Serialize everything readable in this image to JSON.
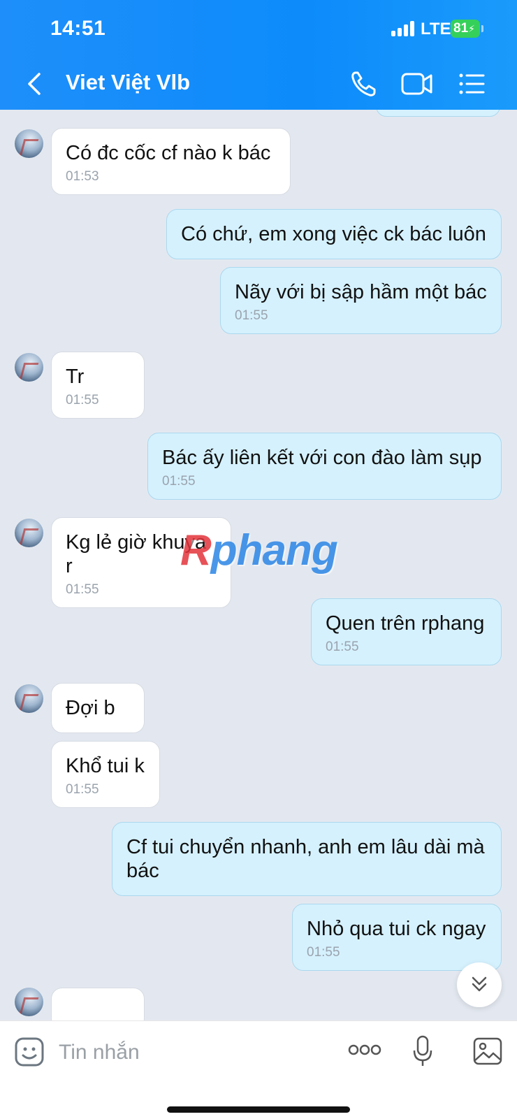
{
  "status_bar": {
    "time": "14:51",
    "network": "LTE",
    "battery": "81"
  },
  "header": {
    "title": "Viet Việt Vlb"
  },
  "messages": [
    {
      "side": "in",
      "text": "Có đc cốc cf nào k bác",
      "time": "01:53"
    },
    {
      "side": "out",
      "text": "Có chứ, em xong việc ck bác luôn",
      "time": ""
    },
    {
      "side": "out",
      "text": "Nãy với bị sập hầm một bác",
      "time": "01:55"
    },
    {
      "side": "in",
      "text": "Tr",
      "time": "01:55"
    },
    {
      "side": "out",
      "text": "Bác ấy liên kết với con đào làm sụp",
      "time": "01:55"
    },
    {
      "side": "in",
      "text": "Kg lẻ giờ khuya r",
      "time": "01:55"
    },
    {
      "side": "out",
      "text": "Quen trên rphang",
      "time": "01:55"
    },
    {
      "side": "in",
      "text": "Đợi b",
      "time": ""
    },
    {
      "side": "in",
      "text": "Khổ tui k",
      "time": "01:55"
    },
    {
      "side": "out",
      "text": "Cf tui chuyển nhanh, anh em lâu dài mà bác",
      "time": ""
    },
    {
      "side": "out",
      "text": "Nhỏ qua tui ck ngay",
      "time": "01:55"
    }
  ],
  "watermark": {
    "prefix": "R",
    "rest": "phang"
  },
  "composer": {
    "placeholder": "Tin nhắn"
  },
  "colors": {
    "header": "#0d8bfb",
    "outgoing_bubble": "#d5f1fe",
    "incoming_bubble": "#ffffff",
    "chat_background": "#e3e8f0"
  }
}
